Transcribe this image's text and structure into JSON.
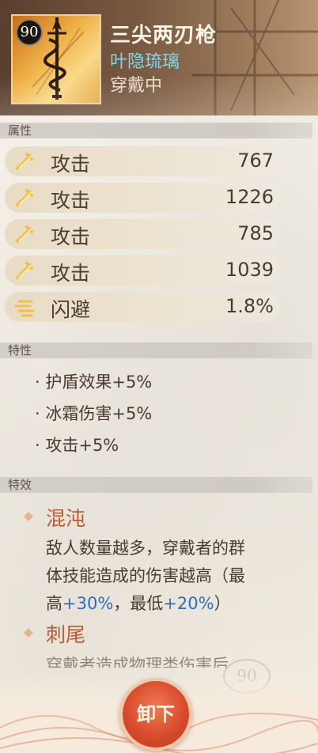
{
  "item": {
    "level": "90",
    "name": "三尖两刃枪",
    "subtitle": "叶隐琉璃",
    "status": "穿戴中",
    "icon": "spear-icon"
  },
  "sections": {
    "attributes": "属性",
    "traits": "特性",
    "effects": "特效"
  },
  "attributes": [
    {
      "label": "攻击",
      "value": "767",
      "icon": "sword-icon"
    },
    {
      "label": "攻击",
      "value": "1226",
      "icon": "sword-icon"
    },
    {
      "label": "攻击",
      "value": "785",
      "icon": "sword-icon"
    },
    {
      "label": "攻击",
      "value": "1039",
      "icon": "sword-icon"
    },
    {
      "label": "闪避",
      "value": "1.8%",
      "icon": "dodge-icon"
    }
  ],
  "traits": [
    "· 护盾效果+5%",
    "· 冰霜伤害+5%",
    "· 攻击+5%"
  ],
  "effects": [
    {
      "title": "混沌",
      "desc_line1": "敌人数量越多，穿戴者的群",
      "desc_line2": "体技能造成的伤害越高（最",
      "desc_line3_a": "高",
      "desc_line3_hl1": "+30%",
      "desc_line3_b": "，最低",
      "desc_line3_hl2": "+20%",
      "desc_line3_c": "）"
    },
    {
      "title": "刺尾",
      "desc_line1": "穿戴者造成物理desc"
    }
  ],
  "buttons": {
    "unequip": "卸下"
  },
  "colors": {
    "accent_title": "#b85c35",
    "highlight": "#2a6fbe",
    "subtitle": "#7fd8ef",
    "button": "#d94c2e"
  },
  "stamp": "90"
}
